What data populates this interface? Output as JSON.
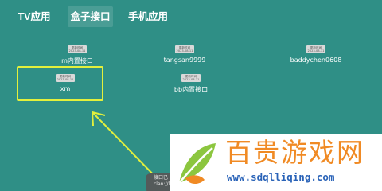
{
  "tabs": [
    {
      "label": "TV应用",
      "active": false
    },
    {
      "label": "盒子接口",
      "active": true
    },
    {
      "label": "手机应用",
      "active": false
    }
  ],
  "items": [
    {
      "badge_line1": "更新时间",
      "badge_line2": "2023-08-11",
      "label": "m内置接口"
    },
    {
      "badge_line1": "更新时间",
      "badge_line2": "2023-08-11",
      "label": "tangsan9999"
    },
    {
      "badge_line1": "更新时间",
      "badge_line2": "2023-08-11",
      "label": "baddychen0608"
    },
    {
      "badge_line1": "更新时间",
      "badge_line2": "2023-08-11",
      "label": "xm",
      "focused": true
    },
    {
      "badge_line1": "更新时间",
      "badge_line2": "2023-08-11",
      "label": "bb内置接口"
    }
  ],
  "toast": {
    "line1": "接口已",
    "line2": "clan://lo"
  },
  "watermark": {
    "title": "百贵游戏网",
    "url": "www.sdqlliqing.com"
  },
  "colors": {
    "background": "#2f8f86",
    "highlight": "#e3f03c",
    "watermark_orange": "#f08a24",
    "watermark_blue": "#2a63b8"
  }
}
